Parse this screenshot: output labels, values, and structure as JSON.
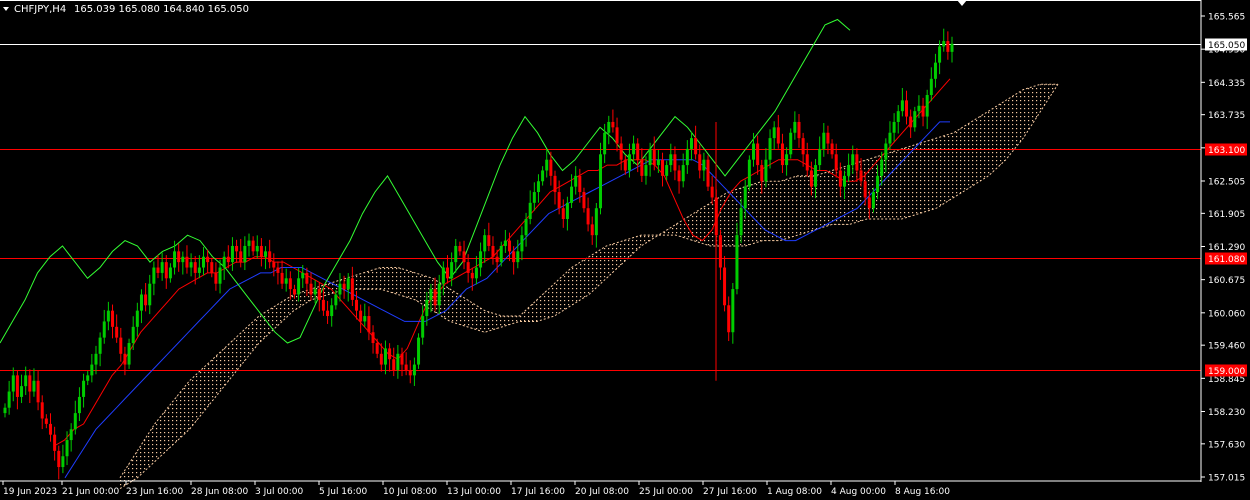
{
  "header": {
    "symbol_label": "CHFJPY,H4",
    "ohlc_text": "165.039 165.080 164.840 165.050"
  },
  "chart_data": {
    "type": "candlestick",
    "symbol": "CHFJPY",
    "timeframe": "H4",
    "ohlc_last": {
      "open": 165.039,
      "high": 165.08,
      "low": 164.84,
      "close": 165.05
    },
    "y_ticks": [
      "165.565",
      "164.950",
      "164.335",
      "163.735",
      "163.120",
      "162.505",
      "161.905",
      "161.290",
      "160.675",
      "160.060",
      "159.460",
      "158.845",
      "158.230",
      "157.630",
      "157.015"
    ],
    "x_ticks": [
      "19 Jun 2023",
      "21 Jun 00:00",
      "23 Jun 16:00",
      "28 Jun 08:00",
      "3 Jul 00:00",
      "5 Jul 16:00",
      "10 Jul 08:00",
      "13 Jul 00:00",
      "17 Jul 16:00",
      "20 Jul 08:00",
      "25 Jul 00:00",
      "27 Jul 16:00",
      "1 Aug 08:00",
      "4 Aug 00:00",
      "8 Aug 16:00"
    ],
    "ylim": [
      157.0,
      165.8
    ],
    "horizontal_levels": [
      {
        "value": 165.05,
        "label": "165.050",
        "kind": "price",
        "color": "#ffffff"
      },
      {
        "value": 163.1,
        "label": "163.100",
        "kind": "level",
        "color": "#ff0000"
      },
      {
        "value": 161.08,
        "label": "161.080",
        "kind": "level",
        "color": "#ff0000"
      },
      {
        "value": 159.0,
        "label": "159.000",
        "kind": "level",
        "color": "#ff0000"
      }
    ],
    "indicator": "Ichimoku Kinko Hyo",
    "series_close": [
      158.3,
      158.6,
      158.9,
      158.5,
      158.7,
      158.9,
      158.6,
      158.8,
      158.4,
      158.1,
      158.0,
      157.8,
      157.5,
      157.2,
      157.4,
      157.7,
      157.9,
      158.2,
      158.5,
      158.8,
      158.9,
      159.1,
      159.3,
      159.6,
      159.9,
      160.1,
      159.8,
      159.6,
      159.3,
      159.1,
      159.5,
      159.8,
      160.1,
      160.4,
      160.2,
      160.6,
      160.9,
      160.8,
      161.0,
      160.7,
      160.9,
      161.2,
      161.0,
      161.1,
      160.9,
      161.0,
      160.8,
      160.9,
      161.1,
      161.0,
      160.8,
      160.6,
      160.9,
      161.1,
      161.0,
      161.3,
      161.2,
      161.0,
      161.3,
      161.4,
      161.2,
      161.3,
      161.1,
      161.2,
      161.0,
      160.9,
      160.8,
      160.6,
      160.7,
      160.5,
      160.4,
      160.7,
      160.8,
      160.6,
      160.4,
      160.5,
      160.3,
      160.1,
      160.0,
      160.2,
      160.4,
      160.6,
      160.5,
      160.7,
      160.3,
      160.1,
      159.9,
      160.0,
      159.7,
      159.5,
      159.3,
      159.1,
      159.4,
      159.2,
      159.0,
      159.3,
      159.1,
      159.0,
      158.9,
      159.1,
      159.6,
      160.0,
      160.3,
      160.5,
      160.2,
      160.6,
      160.9,
      160.7,
      161.0,
      161.3,
      161.2,
      161.0,
      160.8,
      160.7,
      160.9,
      161.2,
      161.5,
      161.3,
      161.1,
      161.0,
      161.3,
      161.4,
      161.2,
      161.0,
      161.2,
      161.5,
      161.8,
      162.1,
      162.3,
      162.5,
      162.7,
      162.9,
      162.6,
      162.3,
      162.0,
      161.8,
      162.1,
      162.4,
      162.6,
      162.3,
      162.0,
      161.7,
      161.5,
      162.0,
      163.0,
      163.4,
      163.6,
      163.5,
      163.2,
      162.9,
      162.7,
      163.0,
      163.2,
      162.9,
      162.6,
      162.8,
      163.1,
      162.8,
      162.9,
      162.6,
      162.8,
      163.0,
      162.7,
      162.5,
      162.8,
      163.1,
      163.3,
      163.0,
      162.7,
      162.9,
      162.4,
      162.2,
      161.5,
      160.9,
      160.2,
      159.7,
      160.5,
      161.5,
      162.0,
      162.4,
      162.9,
      163.2,
      162.8,
      162.5,
      162.9,
      163.3,
      163.5,
      163.2,
      162.8,
      163.0,
      163.4,
      163.6,
      163.3,
      163.0,
      162.7,
      162.4,
      162.8,
      163.1,
      163.4,
      163.2,
      163.0,
      162.7,
      162.4,
      162.6,
      162.8,
      163.0,
      162.7,
      162.5,
      162.2,
      162.0,
      162.3,
      162.6,
      162.9,
      163.2,
      163.4,
      163.6,
      163.8,
      164.0,
      163.7,
      163.5,
      163.8,
      163.9,
      163.7,
      164.1,
      164.4,
      164.7,
      165.0,
      165.1,
      164.9,
      165.05
    ],
    "series_tenkan_red": [
      157.6,
      157.7,
      157.9,
      158.0,
      158.3,
      158.6,
      158.9,
      159.1,
      159.4,
      159.7,
      159.9,
      160.1,
      160.3,
      160.5,
      160.6,
      160.7,
      160.8,
      160.8,
      160.9,
      161.0,
      161.0,
      161.1,
      161.1,
      161.0,
      161.0,
      160.9,
      160.8,
      160.7,
      160.6,
      160.5,
      160.3,
      160.1,
      159.9,
      159.7,
      159.5,
      159.3,
      159.2,
      159.4,
      159.8,
      160.2,
      160.4,
      160.6,
      160.7,
      160.8,
      160.9,
      161.0,
      161.1,
      161.3,
      161.5,
      161.7,
      161.9,
      162.1,
      162.3,
      162.4,
      162.5,
      162.6,
      162.7,
      162.7,
      162.8,
      162.8,
      162.9,
      162.9,
      162.9,
      162.8,
      162.6,
      162.2,
      161.8,
      161.5,
      161.4,
      161.6,
      162.0,
      162.3,
      162.5,
      162.6,
      162.7,
      162.8,
      162.9,
      162.9,
      162.9,
      162.8,
      162.7,
      162.7,
      162.6,
      162.5,
      162.5,
      162.6,
      162.8,
      163.0,
      163.2,
      163.4,
      163.6,
      163.8,
      164.0,
      164.2,
      164.4
    ],
    "series_kijun_blue": [
      157.0,
      157.3,
      157.6,
      157.9,
      158.1,
      158.3,
      158.5,
      158.7,
      158.9,
      159.1,
      159.3,
      159.5,
      159.7,
      159.9,
      160.1,
      160.3,
      160.5,
      160.6,
      160.7,
      160.8,
      160.8,
      160.9,
      160.9,
      160.9,
      160.8,
      160.7,
      160.6,
      160.5,
      160.4,
      160.3,
      160.2,
      160.1,
      160.0,
      159.9,
      159.9,
      159.9,
      160.0,
      160.1,
      160.3,
      160.5,
      160.6,
      160.7,
      160.9,
      161.1,
      161.3,
      161.5,
      161.7,
      161.9,
      162.0,
      162.1,
      162.2,
      162.3,
      162.4,
      162.5,
      162.6,
      162.7,
      162.8,
      162.9,
      162.9,
      162.9,
      162.9,
      162.9,
      162.8,
      162.6,
      162.4,
      162.2,
      162.0,
      161.8,
      161.6,
      161.5,
      161.4,
      161.4,
      161.5,
      161.6,
      161.7,
      161.8,
      161.9,
      162.0,
      162.2,
      162.4,
      162.6,
      162.8,
      163.0,
      163.2,
      163.4,
      163.6,
      163.6
    ],
    "series_chikou_green": [
      159.5,
      159.9,
      160.3,
      160.8,
      161.1,
      161.3,
      161.0,
      160.7,
      160.9,
      161.2,
      161.4,
      161.3,
      161.0,
      161.2,
      161.3,
      161.5,
      161.4,
      161.1,
      160.9,
      160.6,
      160.3,
      160.0,
      159.7,
      159.5,
      159.6,
      160.1,
      160.6,
      161.0,
      161.4,
      161.9,
      162.3,
      162.6,
      162.2,
      161.8,
      161.4,
      161.0,
      160.7,
      161.0,
      161.6,
      162.2,
      162.8,
      163.3,
      163.7,
      163.4,
      163.0,
      162.7,
      162.9,
      163.2,
      163.5,
      163.3,
      163.0,
      162.8,
      163.1,
      163.4,
      163.7,
      163.5,
      163.2,
      162.9,
      162.6,
      162.9,
      163.2,
      163.5,
      163.8,
      164.2,
      164.6,
      165.0,
      165.4,
      165.5,
      165.3
    ],
    "series_senkou_a": [
      157.0,
      157.5,
      158.0,
      158.4,
      158.8,
      159.1,
      159.4,
      159.7,
      160.0,
      160.2,
      160.4,
      160.5,
      160.6,
      160.7,
      160.8,
      160.9,
      160.9,
      160.8,
      160.7,
      160.5,
      160.3,
      160.1,
      160.0,
      159.9,
      159.9,
      160.0,
      160.2,
      160.4,
      160.7,
      161.0,
      161.3,
      161.5,
      161.7,
      161.9,
      162.1,
      162.3,
      162.4,
      162.5,
      162.5,
      162.6,
      162.6,
      162.7,
      162.8,
      162.9,
      163.0,
      163.1,
      163.2,
      163.3,
      163.4,
      163.6,
      163.8,
      164.0,
      164.2,
      164.3,
      164.3
    ],
    "series_senkou_b": [
      156.8,
      157.0,
      157.3,
      157.6,
      157.9,
      158.3,
      158.7,
      159.1,
      159.5,
      159.8,
      160.1,
      160.3,
      160.4,
      160.5,
      160.5,
      160.5,
      160.4,
      160.3,
      160.1,
      159.9,
      159.8,
      159.7,
      159.8,
      160.0,
      160.3,
      160.6,
      160.9,
      161.1,
      161.3,
      161.4,
      161.5,
      161.5,
      161.5,
      161.4,
      161.3,
      161.3,
      161.3,
      161.4,
      161.4,
      161.5,
      161.6,
      161.7,
      161.7,
      161.8,
      161.8,
      161.8,
      161.9,
      162.0,
      162.2,
      162.4,
      162.6,
      162.9,
      163.3,
      163.8,
      164.3
    ]
  }
}
